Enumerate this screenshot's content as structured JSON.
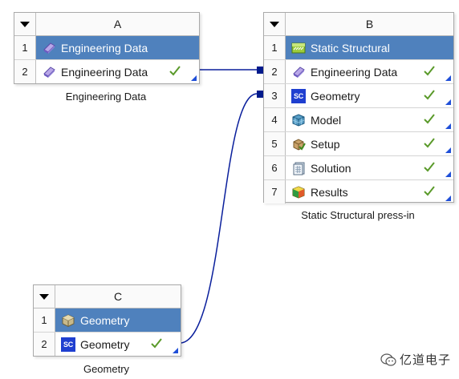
{
  "systems": {
    "a": {
      "letter": "A",
      "caption": "Engineering Data",
      "rows": [
        {
          "num": "1",
          "label": "Engineering Data",
          "icon": "engineering-data-icon",
          "title": true
        },
        {
          "num": "2",
          "label": "Engineering Data",
          "icon": "engineering-data-icon",
          "status": "up-to-date"
        }
      ]
    },
    "b": {
      "letter": "B",
      "caption": "Static Structural press-in",
      "rows": [
        {
          "num": "1",
          "label": "Static Structural",
          "icon": "static-structural-icon",
          "title": true
        },
        {
          "num": "2",
          "label": "Engineering Data",
          "icon": "engineering-data-icon",
          "status": "up-to-date"
        },
        {
          "num": "3",
          "label": "Geometry",
          "icon": "spaceclaim-icon",
          "icon_text": "SC",
          "status": "up-to-date"
        },
        {
          "num": "4",
          "label": "Model",
          "icon": "model-icon",
          "status": "up-to-date"
        },
        {
          "num": "5",
          "label": "Setup",
          "icon": "setup-icon",
          "status": "up-to-date"
        },
        {
          "num": "6",
          "label": "Solution",
          "icon": "solution-icon",
          "status": "up-to-date"
        },
        {
          "num": "7",
          "label": "Results",
          "icon": "results-icon",
          "status": "up-to-date"
        }
      ]
    },
    "c": {
      "letter": "C",
      "caption": "Geometry",
      "rows": [
        {
          "num": "1",
          "label": "Geometry",
          "icon": "geometry-icon",
          "title": true
        },
        {
          "num": "2",
          "label": "Geometry",
          "icon": "spaceclaim-icon",
          "icon_text": "SC",
          "status": "up-to-date"
        }
      ]
    }
  },
  "colors": {
    "title_row": "#4f81bd",
    "check": "#5a9a2a",
    "port": "#001a8c",
    "link": "#0a1f9c"
  },
  "watermark": {
    "text": "亿道电子",
    "icon": "wechat-icon"
  }
}
